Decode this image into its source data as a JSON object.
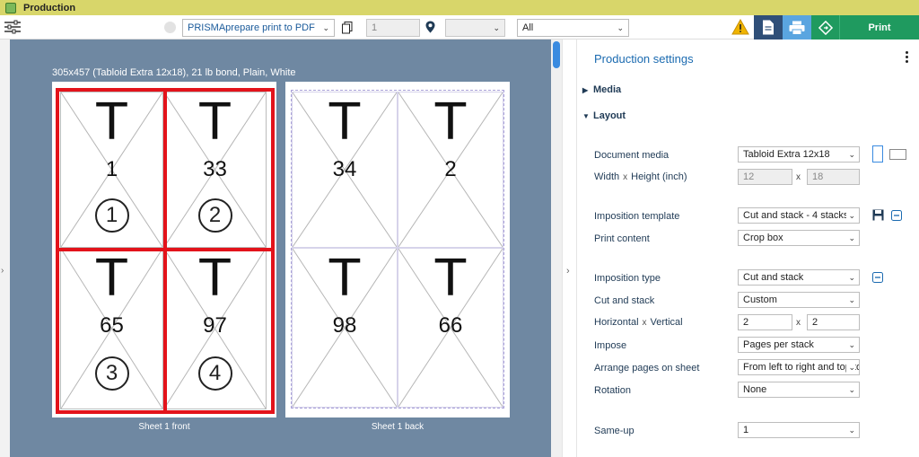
{
  "window": {
    "title": "Production"
  },
  "toolbar": {
    "printer": "PRISMAprepare print to PDF",
    "copies": "1",
    "location_value": "",
    "filter": "All",
    "print_label": "Print"
  },
  "preview": {
    "media_label": "305x457 (Tabloid Extra 12x18), 21 lb bond, Plain, White",
    "front_label": "Sheet 1 front",
    "back_label": "Sheet 1 back",
    "front_pages": [
      {
        "number": "1",
        "stack": "1"
      },
      {
        "number": "33",
        "stack": "2"
      },
      {
        "number": "65",
        "stack": "3"
      },
      {
        "number": "97",
        "stack": "4"
      }
    ],
    "back_pages": [
      {
        "number": "34"
      },
      {
        "number": "2"
      },
      {
        "number": "98"
      },
      {
        "number": "66"
      }
    ]
  },
  "panel": {
    "title": "Production settings",
    "sections": {
      "media": "Media",
      "layout": "Layout"
    },
    "fields": {
      "document_media": {
        "label": "Document media",
        "value": "Tabloid Extra 12x18"
      },
      "size": {
        "label_w": "Width",
        "label_h": "Height (inch)",
        "x": "x",
        "width": "12",
        "height": "18"
      },
      "imposition_template": {
        "label": "Imposition template",
        "value": "Cut and stack - 4 stacks"
      },
      "print_content": {
        "label": "Print content",
        "value": "Crop box"
      },
      "imposition_type": {
        "label": "Imposition type",
        "value": "Cut and stack"
      },
      "cut_and_stack": {
        "label": "Cut and stack",
        "value": "Custom"
      },
      "grid": {
        "label_h": "Horizontal",
        "label_v": "Vertical",
        "x": "x",
        "horizontal": "2",
        "vertical": "2"
      },
      "impose": {
        "label": "Impose",
        "value": "Pages per stack"
      },
      "arrange": {
        "label": "Arrange pages on sheet",
        "value": "From left to right and top to bottom"
      },
      "rotation": {
        "label": "Rotation",
        "value": "None"
      },
      "same_up": {
        "label": "Same-up",
        "value": "1"
      }
    }
  },
  "colors": {
    "accent": "#1a6ab0",
    "print": "#1f9a5f",
    "preview_bg": "#6f88a2",
    "stack_outline": "#e3131b",
    "titlebar": "#d8d66a"
  }
}
